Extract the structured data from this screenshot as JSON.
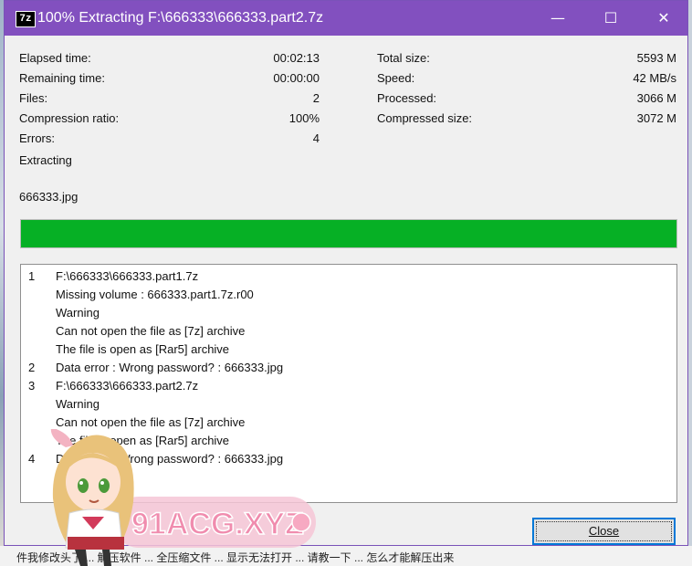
{
  "window": {
    "title": "100% Extracting F:\\666333\\666333.part2.7z",
    "app_icon_label": "7z",
    "controls": {
      "minimize": "—",
      "maximize": "☐",
      "close": "✕"
    }
  },
  "stats_left": [
    {
      "label": "Elapsed time:",
      "value": "00:02:13"
    },
    {
      "label": "Remaining time:",
      "value": "00:00:00"
    },
    {
      "label": "Files:",
      "value": "2"
    },
    {
      "label": "Compression ratio:",
      "value": "100%"
    },
    {
      "label": "Errors:",
      "value": "4"
    }
  ],
  "stats_right": [
    {
      "label": "Total size:",
      "value": "5593 M"
    },
    {
      "label": "Speed:",
      "value": "42 MB/s"
    },
    {
      "label": "Processed:",
      "value": "3066 M"
    },
    {
      "label": "Compressed size:",
      "value": "3072 M"
    }
  ],
  "status": "Extracting",
  "current_file": "666333.jpg",
  "progress": {
    "percent": 100,
    "color": "#06b025"
  },
  "log": [
    {
      "num": "1",
      "text": "F:\\666333\\666333.part1.7z"
    },
    {
      "num": "",
      "text": "Missing volume : 666333.part1.7z.r00"
    },
    {
      "num": "",
      "text": "Warning"
    },
    {
      "num": "",
      "text": "Can not open the file as [7z] archive"
    },
    {
      "num": "",
      "text": "The file is open as [Rar5] archive"
    },
    {
      "num": "2",
      "text": "Data error : Wrong password? : 666333.jpg"
    },
    {
      "num": "3",
      "text": "F:\\666333\\666333.part2.7z"
    },
    {
      "num": "",
      "text": "Warning"
    },
    {
      "num": "",
      "text": "Can not open the file as [7z] archive"
    },
    {
      "num": "",
      "text": "The file is open as [Rar5] archive"
    },
    {
      "num": "4",
      "text": "Data error : Wrong password? : 666333.jpg"
    }
  ],
  "close_button": "Close",
  "watermark": {
    "text": "91ACG.XYZ",
    "color": "#f08cae"
  },
  "background_text": "件我修改头了  ...  解压软件  ...  全压缩文件  ...  显示无法打开  ...  请教一下  ...  怎么才能解压出来"
}
